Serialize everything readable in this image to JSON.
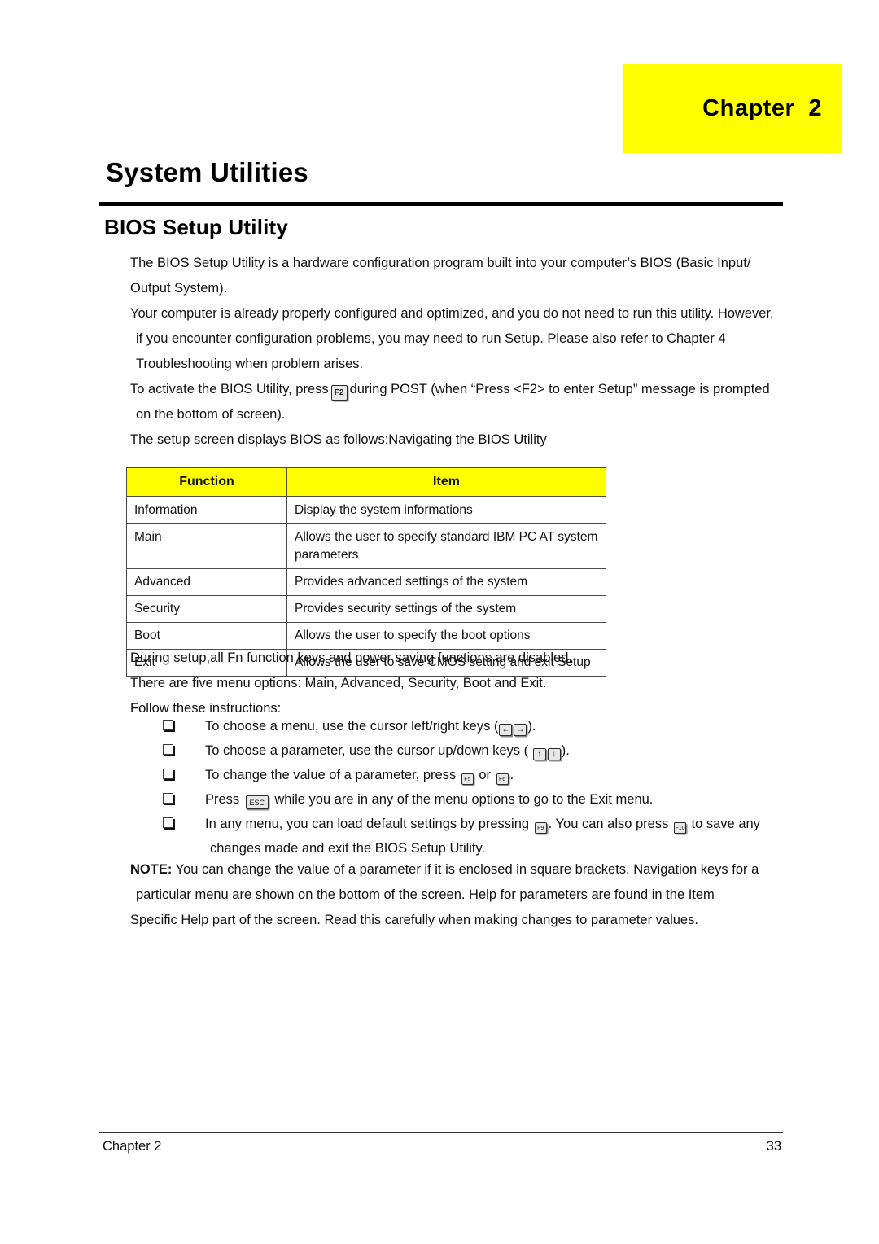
{
  "chapter_tab": {
    "label": "Chapter  2",
    "background_color": "#ffff00"
  },
  "page_title": "System Utilities",
  "section_heading": "BIOS Setup Utility",
  "intro_paragraphs": [
    "The BIOS Setup Utility is a hardware configuration program built into your computer’s BIOS (Basic Input/",
    "Output System).",
    "Your computer is already properly configured and optimized, and you do not need to run this utility. However,",
    "if you encounter configuration problems, you may need to run Setup.  Please also refer to Chapter 4",
    "Troubleshooting when problem arises."
  ],
  "activate_line": {
    "before_key": "To activate the BIOS Utility, press",
    "key": "F2",
    "after_key": "during POST (when “Press <F2> to enter Setup” message is prompted",
    "continuation": "on the bottom of screen)."
  },
  "setup_screen_line": "The setup screen displays BIOS as follows:Navigating the BIOS Utility",
  "table": {
    "header_background": "#ffff00",
    "columns": [
      "Function",
      "Item"
    ],
    "rows": [
      [
        "Information",
        "Display the system informations"
      ],
      [
        "Main",
        "Allows the user to specify standard IBM PC AT system parameters"
      ],
      [
        "Advanced",
        "Provides advanced settings of the system"
      ],
      [
        "Security",
        "Provides security settings of the system"
      ],
      [
        "Boot",
        "Allows the user to specify the boot options"
      ],
      [
        "Exit",
        "Allows the user to save CMOS setting and exit Setup"
      ]
    ]
  },
  "post_table_paragraphs": [
    "During setup,all Fn function keys and power saving functions are disabled.",
    "There are five menu options: Main, Advanced, Security, Boot and Exit.",
    "Follow these instructions:"
  ],
  "bullets": [
    {
      "text_before": "To choose a menu, use the cursor left/right keys (",
      "keys": [
        "←",
        "→"
      ],
      "text_after": ")."
    },
    {
      "text_before": "To choose a parameter, use the cursor up/down keys ( ",
      "keys": [
        "↑",
        "↓"
      ],
      "text_after": ")."
    },
    {
      "text_before": "To change the value of a parameter, press ",
      "keys": [
        "F5",
        "F6"
      ],
      "separator": " or ",
      "text_after": "."
    },
    {
      "text_before": "Press ",
      "keys": [
        "ESC"
      ],
      "text_after": " while you are in any of the menu options to go to the Exit menu."
    },
    {
      "text_before": "In any menu, you can load default settings by pressing ",
      "keys": [
        "F9",
        "F10"
      ],
      "text_middle": ". You can also press ",
      "text_after": " to save any",
      "continuation": "changes made and exit the BIOS Setup Utility."
    }
  ],
  "note": {
    "label": "NOTE:",
    "lines": [
      " You can change the value of a parameter if it is enclosed in square brackets. Navigation keys for a",
      "particular menu are shown on the bottom of the screen. Help for parameters are found in the Item",
      "Specific Help part of the screen. Read this carefully when making changes to parameter values."
    ]
  },
  "footer": {
    "left": "Chapter 2",
    "page_number": "33"
  }
}
